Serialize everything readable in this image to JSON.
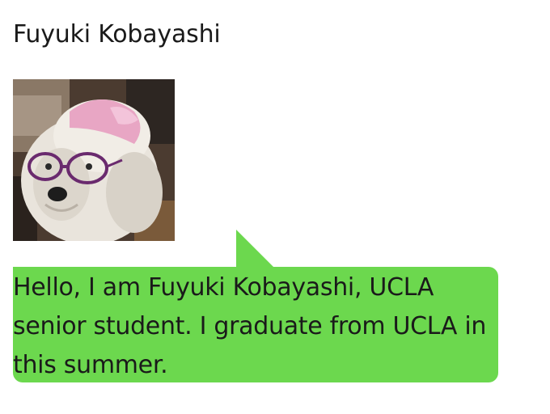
{
  "profile": {
    "name": "Fuyuki Kobayashi",
    "avatar_icon": "dog-with-glasses-photo"
  },
  "message": {
    "text": "Hello, I am Fuyuki Kobayashi, UCLA senior student. I graduate from UCLA in this summer.",
    "bubble_color": "#6cd84e"
  }
}
